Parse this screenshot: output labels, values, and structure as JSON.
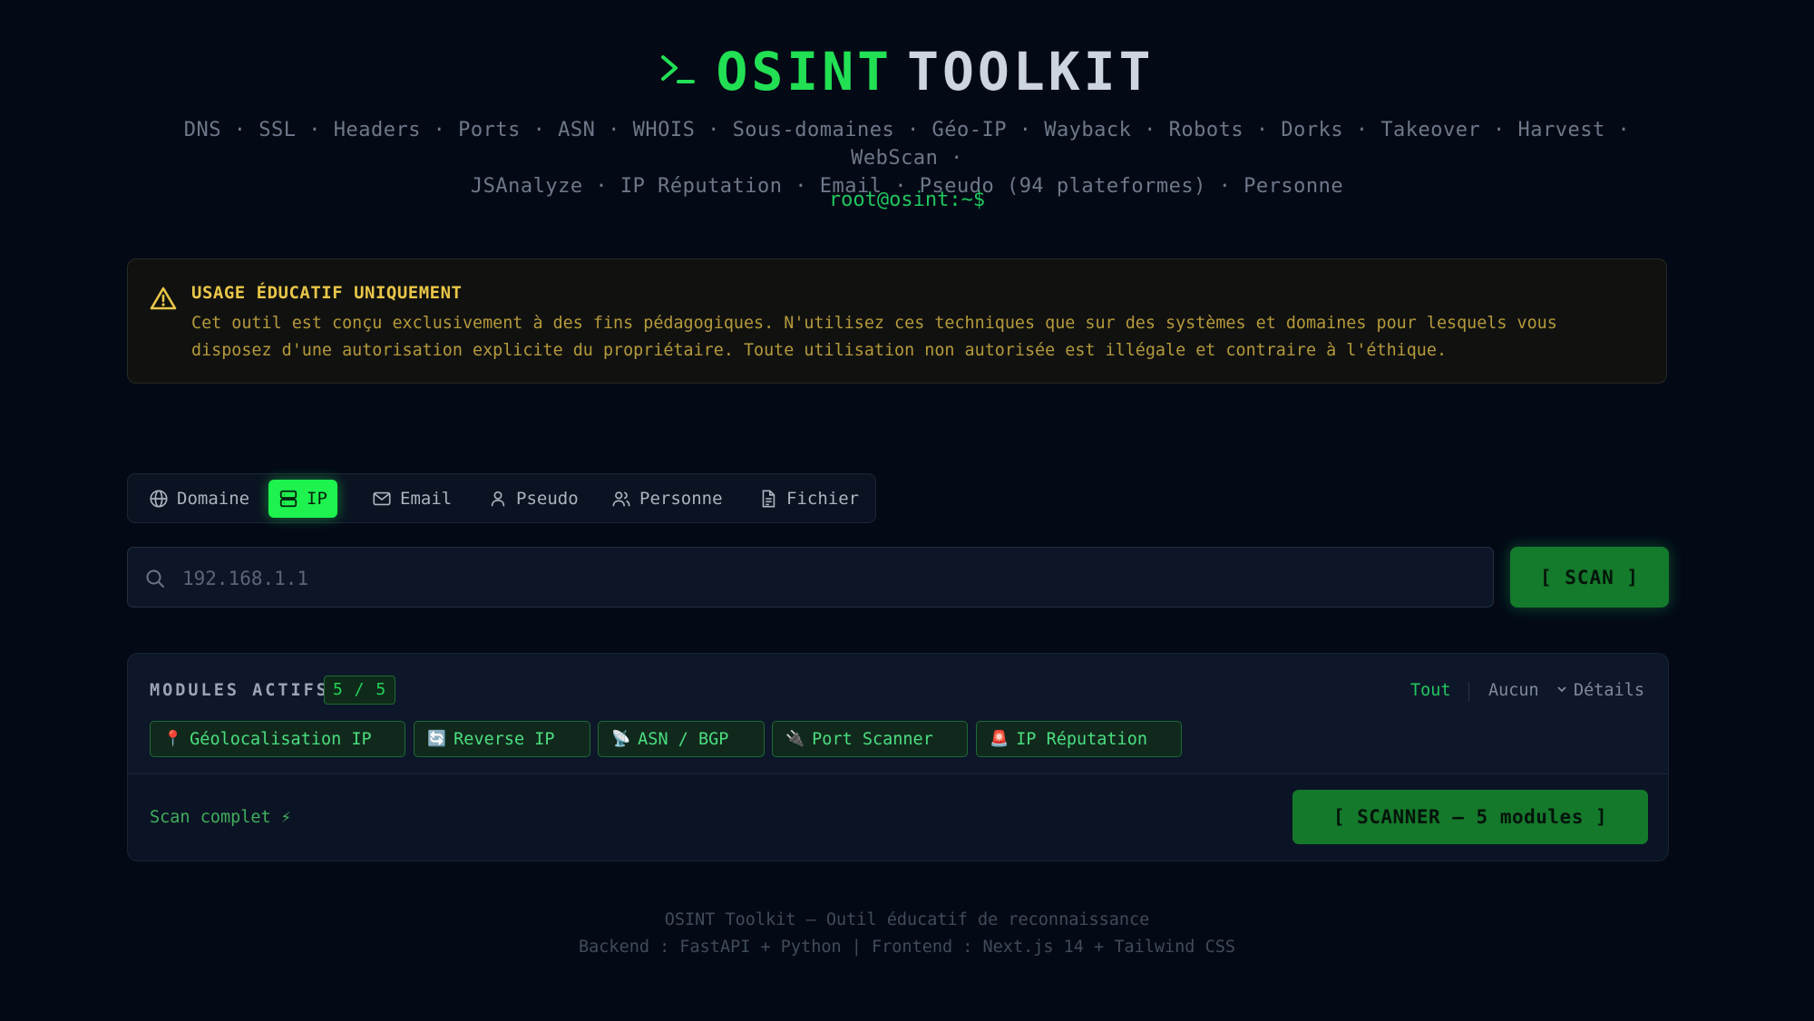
{
  "header": {
    "title_part1": "OSINT",
    "title_part2": "TOOLKIT",
    "subtitle_line1": "DNS · SSL · Headers · Ports · ASN · WHOIS · Sous-domaines · Géo-IP · Wayback · Robots · Dorks · Takeover · Harvest · WebScan ·",
    "subtitle_line2": "JSAnalyze · IP Réputation · Email · Pseudo (94 plateformes) · Personne",
    "prompt": "root@osint:~$",
    "accent_color": "#22e054"
  },
  "warning": {
    "title": "USAGE ÉDUCATIF UNIQUEMENT",
    "text": "Cet outil est conçu exclusivement à des fins pédagogiques. N'utilisez ces techniques que sur des systèmes et domaines pour lesquels vous disposez d'une autorisation explicite du propriétaire. Toute utilisation non autorisée est illégale et contraire à l'éthique.",
    "color": "#e9c648"
  },
  "tabs": [
    {
      "label": "Domaine",
      "icon": "globe-icon",
      "active": false
    },
    {
      "label": "IP",
      "icon": "server-icon",
      "active": true
    },
    {
      "label": "Email",
      "icon": "mail-icon",
      "active": false
    },
    {
      "label": "Pseudo",
      "icon": "user-icon",
      "active": false
    },
    {
      "label": "Personne",
      "icon": "users-icon",
      "active": false
    },
    {
      "label": "Fichier",
      "icon": "file-icon",
      "active": false
    }
  ],
  "search": {
    "placeholder": "192.168.1.1",
    "value": "",
    "scan_label": "[ SCAN ]"
  },
  "modules": {
    "label": "MODULES ACTIFS",
    "count": "5 / 5",
    "select_all": "Tout",
    "select_none": "Aucun",
    "details": "Détails",
    "items": [
      {
        "label": "Géolocalisation IP",
        "icon": "📍"
      },
      {
        "label": "Reverse IP",
        "icon": "🔄"
      },
      {
        "label": "ASN / BGP",
        "icon": "📡"
      },
      {
        "label": "Port Scanner",
        "icon": "🔌"
      },
      {
        "label": "IP Réputation",
        "icon": "🚨"
      }
    ],
    "status": "Scan complet ⚡",
    "scanner_label": "[ SCANNER — 5 modules ]"
  },
  "footer": {
    "line1": "OSINT Toolkit — Outil éducatif de reconnaissance",
    "line2": "Backend : FastAPI + Python | Frontend : Next.js 14 + Tailwind CSS"
  }
}
